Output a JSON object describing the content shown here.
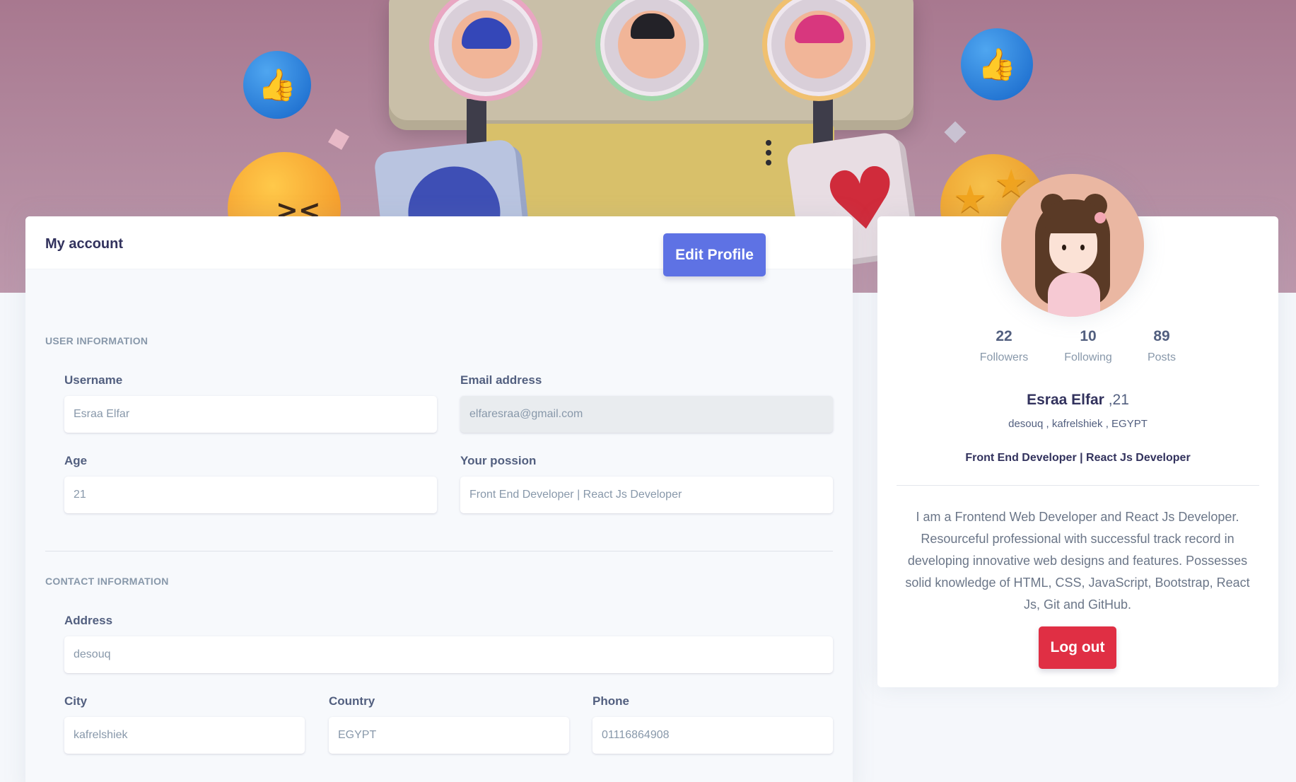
{
  "account": {
    "title": "My account",
    "edit_button": "Edit Profile",
    "user_info_heading": "USER INFORMATION",
    "contact_info_heading": "CONTACT INFORMATION",
    "fields": {
      "username": {
        "label": "Username",
        "value": "Esraa Elfar"
      },
      "email": {
        "label": "Email address",
        "value": "elfaresraa@gmail.com"
      },
      "age": {
        "label": "Age",
        "value": "21"
      },
      "passion": {
        "label": "Your possion",
        "value": "Front End Developer | React Js Developer"
      },
      "address": {
        "label": "Address",
        "value": "desouq"
      },
      "city": {
        "label": "City",
        "value": "kafrelshiek"
      },
      "country": {
        "label": "Country",
        "value": "EGYPT"
      },
      "phone": {
        "label": "Phone",
        "value": "01116864908"
      }
    }
  },
  "profile": {
    "stats": [
      {
        "value": "22",
        "label": "Followers"
      },
      {
        "value": "10",
        "label": "Following"
      },
      {
        "value": "89",
        "label": "Posts"
      }
    ],
    "name": "Esraa Elfar",
    "age": " ,21",
    "location": "desouq , kafrelshiek , EGYPT",
    "role": "Front End Developer | React Js Developer",
    "bio": "I am a Frontend Web Developer and React Js Developer. Resourceful professional with successful track record in developing innovative web designs and features. Possesses solid knowledge of HTML, CSS, JavaScript, Bootstrap, React Js, Git and GitHub.",
    "logout_button": "Log out"
  },
  "colors": {
    "primary": "#5e72e4",
    "danger": "#e02f44",
    "banner": "#a8788f",
    "background": "#f5f7fb"
  }
}
